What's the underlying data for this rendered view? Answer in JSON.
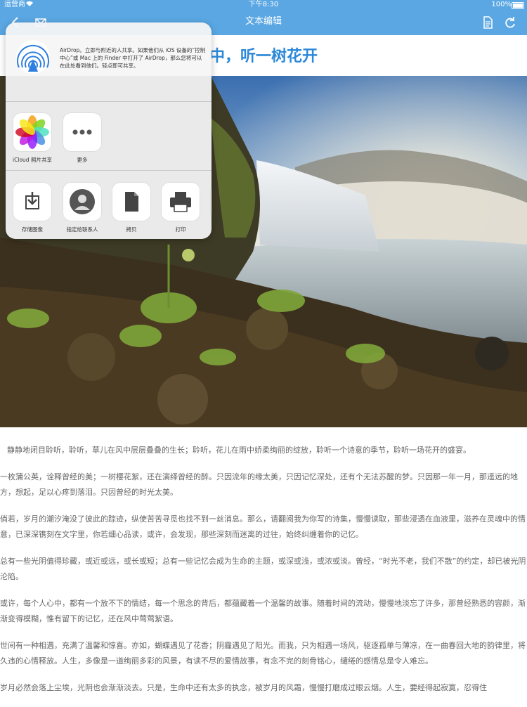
{
  "status_bar": {
    "carrier": "运营商",
    "time": "下午8:30",
    "battery": "100%"
  },
  "nav": {
    "title": "文本编辑",
    "left_icons": [
      "back-icon",
      "mail-icon"
    ],
    "right_icons": [
      "document-icon",
      "refresh-icon"
    ]
  },
  "headline": "中，听一树花开",
  "share_sheet": {
    "airdrop_text": "AirDrop。立即与附近的人共享。如果他们从 iOS 设备的“控制中心”或 Mac 上的 Finder 中打开了 AirDrop，那么您将可以在此处看到他们。轻点即可共享。",
    "row1": [
      {
        "label": "iCloud 照片共享",
        "icon": "photos-icon"
      },
      {
        "label": "更多",
        "icon": "more-icon"
      }
    ],
    "row2": [
      {
        "label": "存储图像",
        "icon": "save-image-icon"
      },
      {
        "label": "指定给联系人",
        "icon": "contact-icon"
      },
      {
        "label": "拷贝",
        "icon": "copy-icon"
      },
      {
        "label": "打印",
        "icon": "print-icon"
      }
    ]
  },
  "article": {
    "paragraphs": [
      "静静地闭目聆听，聆听，草儿在风中层层叠叠的生长；聆听，花儿在雨中娇柔绚丽的绽放，聆听一个诗意的季节，聆听一场花开的盛宴。",
      "一枚蒲公英，诠释曾经的美；一树樱花絮，还在演绎曾经的醉。只因流年的缘太美，只因记忆深处，还有个无法苏醒的梦。只因那一年一月，那遥远的地方，想起，足以心疼到落泪。只因曾经的时光太美。",
      "倘若，岁月的潮汐淹没了彼此的踪迹，纵使苦苦寻觅也找不到一丝消息。那么，请翻阅我为你写的诗集，慢慢读取，那些浸透在血液里，滋养在灵魂中的情意，已深深镌刻在文字里，你若细心品读，或许，会发现，那些深刻而迷离的过往，始终纠缠着你的记忆。",
      "总有一些光阴值得珍藏，或近或远，或长或短；总有一些记忆会成为生命的主题，或深或浅，或浓或淡。曾经，“时光不老，我们不散”的约定，却已被光阴沦陷。",
      "或许，每个人心中，都有一个放不下的情结，每一个思念的背后，都蕴藏着一个温馨的故事。随着时间的流动，慢慢地淡忘了许多，那曾经熟悉的容颜，渐渐变得模糊，惟有留下的记忆，还在风中莺莺絮语。",
      "世间有一种相遇，充满了温馨和惊喜。亦如，蝴蝶遇见了花香；阴霾遇见了阳光。而我，只为相遇一场风，驱逐孤单与薄凉，在一曲春回大地的韵律里，将久违的心情释放。人生，多像是一道绚丽多彩的风景，有读不尽的爱情故事，有念不完的刻骨铭心，缱绻的感情总是令人难忘。",
      "岁月必然会落上尘埃，光阴也会渐渐淡去。只是，生命中还有太多的执念，被岁月的风霜，慢慢打磨成过眼云烟。人生，要经得起寂寞，忍得住"
    ]
  },
  "colors": {
    "nav_bg": "#5aa7e3",
    "headline": "#2b88d8"
  }
}
